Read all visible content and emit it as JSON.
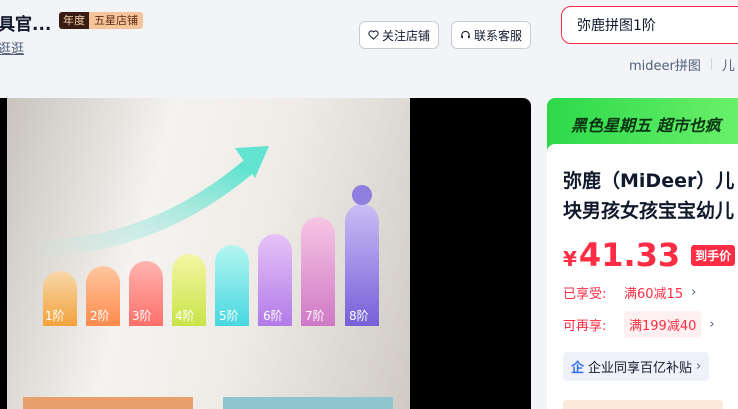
{
  "shop": {
    "name": "具官...",
    "badge_year": "年度",
    "badge_rank": "五星店铺",
    "visit_link": "逛逛"
  },
  "actions": {
    "follow_label": "关注店铺",
    "service_label": "联系客服"
  },
  "search": {
    "query": "弥鹿拼图1阶",
    "hot_words": [
      "mideer拼图",
      "儿"
    ]
  },
  "gallery": {
    "steps": [
      "1阶",
      "2阶",
      "3阶",
      "4阶",
      "5阶",
      "6阶",
      "7阶",
      "8阶"
    ]
  },
  "promo": {
    "banner": "黑色星期五 超市也疯",
    "title_line1": "弥鹿（MiDeer）儿",
    "title_line2": "块男孩女孩宝宝幼儿",
    "currency": "¥",
    "price": "41.33",
    "price_tag": "到手价",
    "original_price": "¥",
    "enjoyed_label": "已享受:",
    "enjoyed_value": "满60减15",
    "available_label": "可再享:",
    "available_value": "满199减40",
    "subsidy_label": "企业同享百亿补贴"
  },
  "colors": {
    "accent": "#ff2d43",
    "banner_green": "#2cd94a"
  }
}
